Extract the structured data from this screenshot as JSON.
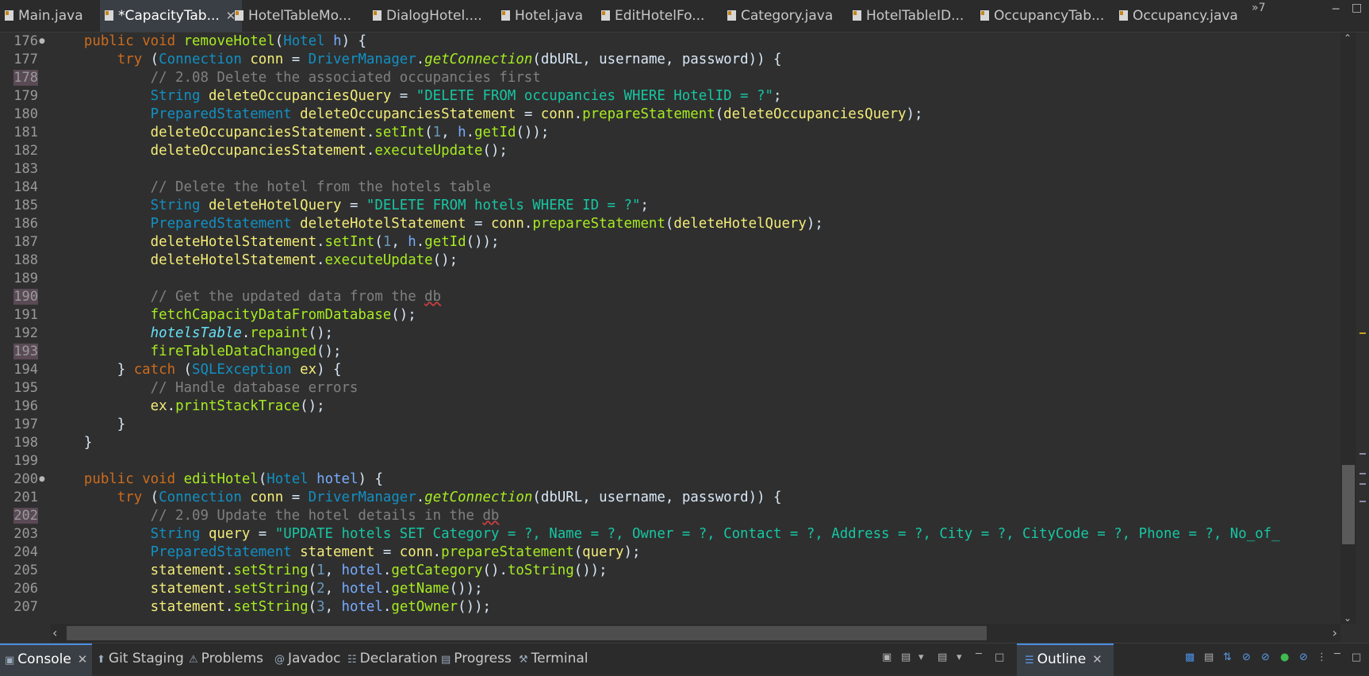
{
  "editor_tabs": [
    {
      "label": "Main.java",
      "active": false,
      "closable": false
    },
    {
      "label": "*CapacityTab...",
      "active": true,
      "closable": true
    },
    {
      "label": "HotelTableMo...",
      "active": false,
      "closable": false
    },
    {
      "label": "DialogHotel....",
      "active": false,
      "closable": false
    },
    {
      "label": "Hotel.java",
      "active": false,
      "closable": false
    },
    {
      "label": "EditHotelFo...",
      "active": false,
      "closable": false
    },
    {
      "label": "Category.java",
      "active": false,
      "closable": false
    },
    {
      "label": "HotelTableID...",
      "active": false,
      "closable": false
    },
    {
      "label": "OccupancyTab...",
      "active": false,
      "closable": false
    },
    {
      "label": "Occupancy.java",
      "active": false,
      "closable": false
    }
  ],
  "more_tabs_label": "»7",
  "editor": {
    "first_line": 176,
    "highlighted_lines": [
      "178",
      "190",
      "193",
      "202"
    ],
    "fold_lines": [
      "176",
      "200"
    ],
    "lines": [
      "    public void removeHotel(Hotel h) {",
      "        try (Connection conn = DriverManager.getConnection(dbURL, username, password)) {",
      "            // 2.08 Delete the associated occupancies first",
      "            String deleteOccupanciesQuery = \"DELETE FROM occupancies WHERE HotelID = ?\";",
      "            PreparedStatement deleteOccupanciesStatement = conn.prepareStatement(deleteOccupanciesQuery);",
      "            deleteOccupanciesStatement.setInt(1, h.getId());",
      "            deleteOccupanciesStatement.executeUpdate();",
      "",
      "            // Delete the hotel from the hotels table",
      "            String deleteHotelQuery = \"DELETE FROM hotels WHERE ID = ?\";",
      "            PreparedStatement deleteHotelStatement = conn.prepareStatement(deleteHotelQuery);",
      "            deleteHotelStatement.setInt(1, h.getId());",
      "            deleteHotelStatement.executeUpdate();",
      "",
      "            // Get the updated data from the db",
      "            fetchCapacityDataFromDatabase();",
      "            hotelsTable.repaint();",
      "            fireTableDataChanged();",
      "        } catch (SQLException ex) {",
      "            // Handle database errors",
      "            ex.printStackTrace();",
      "        }",
      "    }",
      "",
      "    public void editHotel(Hotel hotel) {",
      "        try (Connection conn = DriverManager.getConnection(dbURL, username, password)) {",
      "            // 2.09 Update the hotel details in the db",
      "            String query = \"UPDATE hotels SET Category = ?, Name = ?, Owner = ?, Contact = ?, Address = ?, City = ?, CityCode = ?, Phone = ?, No_of_",
      "            PreparedStatement statement = conn.prepareStatement(query);",
      "            statement.setString(1, hotel.getCategory().toString());",
      "            statement.setString(2, hotel.getName());",
      "            statement.setString(3, hotel.getOwner());"
    ]
  },
  "bottom_tabs": [
    {
      "label": "Console",
      "icon": "console-icon",
      "active": true,
      "closable": true
    },
    {
      "label": "Git Staging",
      "icon": "git-staging-icon",
      "active": false,
      "closable": false
    },
    {
      "label": "Problems",
      "icon": "problems-icon",
      "active": false,
      "closable": false
    },
    {
      "label": "Javadoc",
      "icon": "javadoc-icon",
      "active": false,
      "closable": false
    },
    {
      "label": "Declaration",
      "icon": "declaration-icon",
      "active": false,
      "closable": false
    },
    {
      "label": "Progress",
      "icon": "progress-icon",
      "active": false,
      "closable": false
    },
    {
      "label": "Terminal",
      "icon": "terminal-icon",
      "active": false,
      "closable": false
    }
  ],
  "outline_tab": {
    "label": "Outline",
    "icon": "outline-icon",
    "active": true,
    "closable": true
  },
  "colors": {
    "keyword": "#cc6c1d",
    "type": "#1290c3",
    "comment": "#808080",
    "string": "#17c6a3",
    "method": "#a7ec21",
    "field": "#66e1f8",
    "variable": "#f3ec79",
    "background": "#2f2f2f"
  }
}
